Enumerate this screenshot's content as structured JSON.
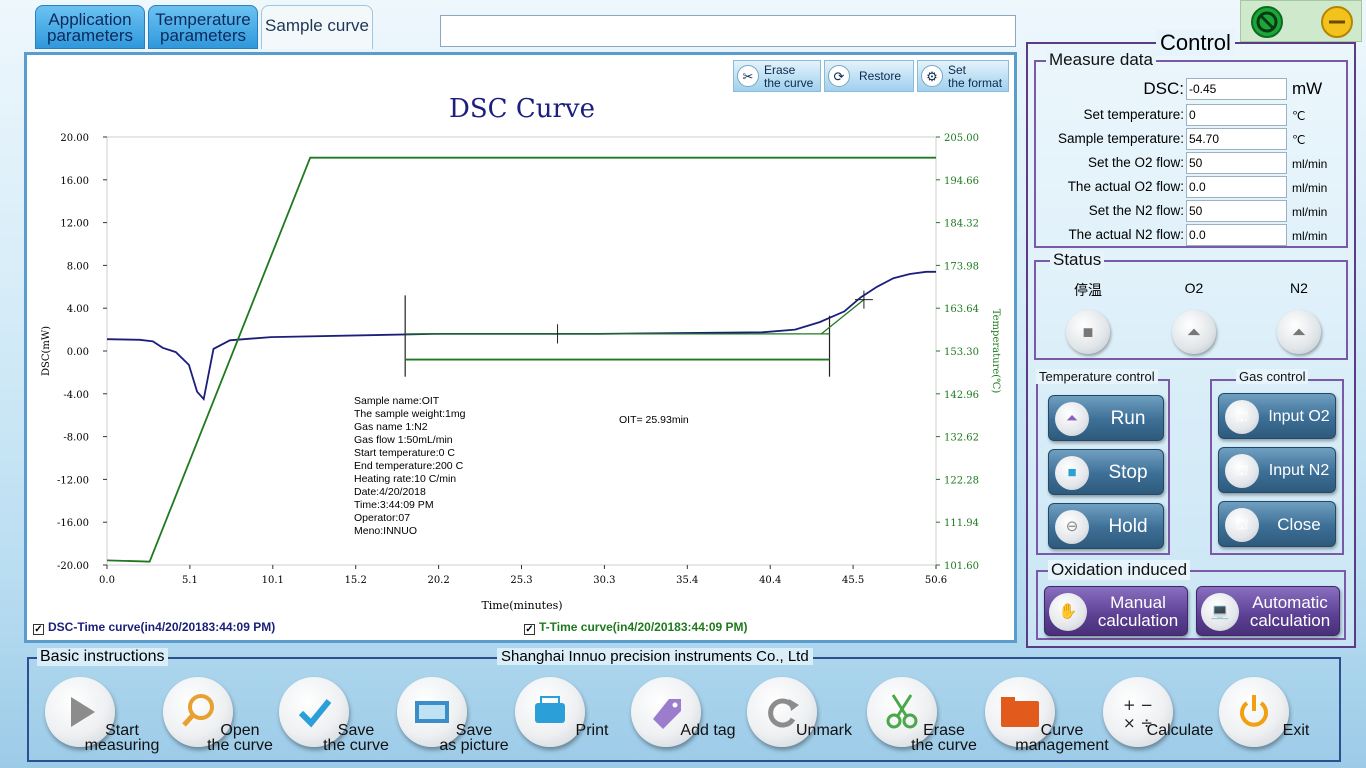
{
  "tabs": [
    {
      "line1": "Application",
      "line2": "parameters"
    },
    {
      "line1": "Temperature",
      "line2": "parameters"
    },
    {
      "label": "Sample curve"
    }
  ],
  "chart_toolbar": {
    "erase_line1": "Erase",
    "erase_line2": "the curve",
    "restore": "Restore",
    "set_line1": "Set",
    "set_line2": "the format"
  },
  "legend_items": {
    "dsc": "DSC-Time curve(in4/20/20183:44:09 PM)",
    "temp": "T-Time curve(in4/20/20183:44:09 PM)"
  },
  "chart_data": {
    "type": "line",
    "title": "DSC Curve",
    "xlabel": "Time(minutes)",
    "ylabel_left": "DSC(mW)",
    "ylabel_right": "Temperature(℃)",
    "xlim": [
      0,
      50.6
    ],
    "ylim_left": [
      -20,
      20
    ],
    "ylim_right": [
      101.6,
      205
    ],
    "x_ticks": [
      "0.0",
      "5.1",
      "10.1",
      "15.2",
      "20.2",
      "25.3",
      "30.3",
      "35.4",
      "40.4",
      "45.5",
      "50.6"
    ],
    "y_left_ticks": [
      "20.00",
      "16.00",
      "12.00",
      "8.00",
      "4.00",
      "0.00",
      "-4.00",
      "-8.00",
      "-12.00",
      "-16.00",
      "-20.00"
    ],
    "y_right_ticks": [
      "205.00",
      "194.66",
      "184.32",
      "173.98",
      "163.64",
      "153.30",
      "142.96",
      "132.62",
      "122.28",
      "111.94",
      "101.60"
    ],
    "series": [
      {
        "name": "DSC-Time curve",
        "axis": "left",
        "color": "#1b1f7a",
        "x": [
          0,
          2.0,
          2.8,
          3.4,
          4.2,
          5.0,
          5.5,
          5.9,
          6.5,
          7.5,
          10,
          20,
          30,
          40,
          42,
          43.5,
          45,
          46,
          47,
          48,
          49,
          50,
          50.6
        ],
        "y": [
          1.1,
          1.05,
          0.9,
          0.3,
          -0.1,
          -1.3,
          -3.8,
          -4.5,
          0.2,
          1.0,
          1.3,
          1.6,
          1.6,
          1.75,
          2.0,
          2.7,
          3.7,
          5.0,
          6.0,
          6.8,
          7.2,
          7.4,
          7.4
        ]
      },
      {
        "name": "T-Time curve",
        "axis": "right",
        "color": "#1f7a1f",
        "x": [
          0,
          2.0,
          2.6,
          12.4,
          50.6
        ],
        "y": [
          102.7,
          102.5,
          102.4,
          200.0,
          200.0
        ]
      }
    ],
    "annotations": {
      "info_lines": [
        "Sample name:OIT",
        "The sample weight:1mg",
        "Gas name 1:N2",
        "Gas flow 1:50mL/min",
        "Start temperature:0 C",
        "End temperature:200 C",
        "Heating rate:10 C/min",
        "Date:4/20/2018",
        "Time:3:44:09 PM",
        "Operator:07",
        "Meno:INNUO"
      ],
      "oit_text": "OIT= 25.93min",
      "oit_start_x": 18.2,
      "oit_end_x": 44.1,
      "oit_line_y": -0.8,
      "baseline_y": 1.6,
      "marker1_x": 27.5,
      "marker2_x": 46.2,
      "marker2_y": 4.8
    }
  },
  "control": {
    "title": "Control",
    "measure_title": "Measure data",
    "measure_rows": [
      {
        "label": "DSC:",
        "value": "-0.45",
        "unit": "mW"
      },
      {
        "label": "Set temperature:",
        "value": "0",
        "unit": "℃"
      },
      {
        "label": "Sample temperature:",
        "value": "54.70",
        "unit": "℃"
      },
      {
        "label": "Set the O2 flow:",
        "value": "50",
        "unit": "ml/min"
      },
      {
        "label": "The actual O2 flow:",
        "value": "0.0",
        "unit": "ml/min"
      },
      {
        "label": "Set the N2 flow:",
        "value": "50",
        "unit": "ml/min"
      },
      {
        "label": "The actual N2 flow:",
        "value": "0.0",
        "unit": "ml/min"
      }
    ],
    "status_title": "Status",
    "status": [
      "停温",
      "O2",
      "N2"
    ],
    "temp_control_title": "Temperature control",
    "temp_buttons": [
      "Run",
      "Stop",
      "Hold"
    ],
    "gas_control_title": "Gas control",
    "gas_buttons": [
      "Input O2",
      "Input N2",
      "Close"
    ],
    "oxidation_title": "Oxidation induced",
    "manual_line1": "Manual",
    "manual_line2": "calculation",
    "auto_line1": "Automatic",
    "auto_line2": "calculation"
  },
  "bottom": {
    "title": "Basic instructions",
    "company": "Shanghai Innuo precision instruments Co., Ltd",
    "buttons": [
      {
        "line1": "Start",
        "line2": "measuring",
        "icon": "play-icon"
      },
      {
        "line1": "Open",
        "line2": "the curve",
        "icon": "magnifier-icon"
      },
      {
        "line1": "Save",
        "line2": "the curve",
        "icon": "check-icon"
      },
      {
        "line1": "Save",
        "line2": "as picture",
        "icon": "film-icon"
      },
      {
        "line1": "",
        "line2": "Print",
        "icon": "printer-icon"
      },
      {
        "line1": "",
        "line2": "Add tag",
        "icon": "tag-icon"
      },
      {
        "line1": "",
        "line2": "Unmark",
        "icon": "refresh-icon"
      },
      {
        "line1": "Erase",
        "line2": "the curve",
        "icon": "scissors-icon"
      },
      {
        "line1": "Curve",
        "line2": "management",
        "icon": "folder-icon"
      },
      {
        "line1": "",
        "line2": "Calculate",
        "icon": "calculator-icon"
      },
      {
        "line1": "",
        "line2": "Exit",
        "icon": "power-icon"
      }
    ]
  }
}
